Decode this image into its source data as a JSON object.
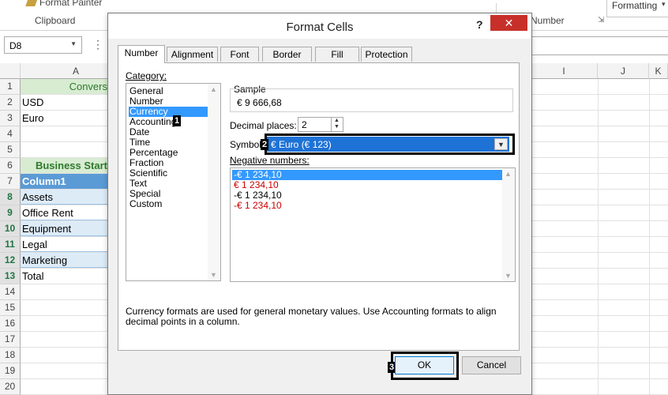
{
  "ribbon": {
    "format_painter": "Format Painter",
    "clipboard_group": "Clipboard",
    "number_group": "Number",
    "formatting_button": "Formatting"
  },
  "formula_bar": {
    "name_box": "D8",
    "dots": "⋮"
  },
  "grid": {
    "columns": [
      "A",
      "I",
      "J",
      "K"
    ],
    "rows": [
      "1",
      "2",
      "3",
      "4",
      "5",
      "6",
      "7",
      "8",
      "9",
      "10",
      "11",
      "12",
      "13",
      "14",
      "15",
      "16",
      "17",
      "18",
      "19",
      "20"
    ],
    "selected_rows": [
      "8",
      "9",
      "10",
      "11",
      "12",
      "13"
    ],
    "cells": {
      "a1": "Convers",
      "a2": "USD",
      "a3": "Euro",
      "a6": "Business Start",
      "a7": "Column1",
      "a8": "Assets",
      "a9": "Office Rent",
      "a10": "Equipment",
      "a11": "Legal",
      "a12": "Marketing",
      "a13": "Total"
    }
  },
  "dialog": {
    "title": "Format Cells",
    "help": "?",
    "close": "✕",
    "tabs": [
      "Number",
      "Alignment",
      "Font",
      "Border",
      "Fill",
      "Protection"
    ],
    "category_label": "Category:",
    "categories": [
      "General",
      "Number",
      "Currency",
      "Accounting",
      "Date",
      "Time",
      "Percentage",
      "Fraction",
      "Scientific",
      "Text",
      "Special",
      "Custom"
    ],
    "selected_category": "Currency",
    "sample_label": "Sample",
    "sample_value": "€ 9 666,68",
    "decimal_label": "Decimal places:",
    "decimal_value": "2",
    "symbol_label": "Symbol:",
    "symbol_value": "€ Euro (€ 123)",
    "negative_label": "Negative numbers:",
    "negative_numbers": [
      "-€ 1 234,10",
      "€ 1 234,10",
      "-€ 1 234,10",
      "-€ 1 234,10"
    ],
    "description": "Currency formats are used for general monetary values.  Use Accounting formats to align decimal points in a column.",
    "ok": "OK",
    "cancel": "Cancel"
  },
  "annotations": [
    "1",
    "2",
    "3"
  ],
  "colors": {
    "accent_green": "#217346",
    "selection_blue": "#3399ff",
    "close_red": "#c7302a",
    "negative_red": "#cc0000",
    "table_header": "#5b9bd5"
  }
}
